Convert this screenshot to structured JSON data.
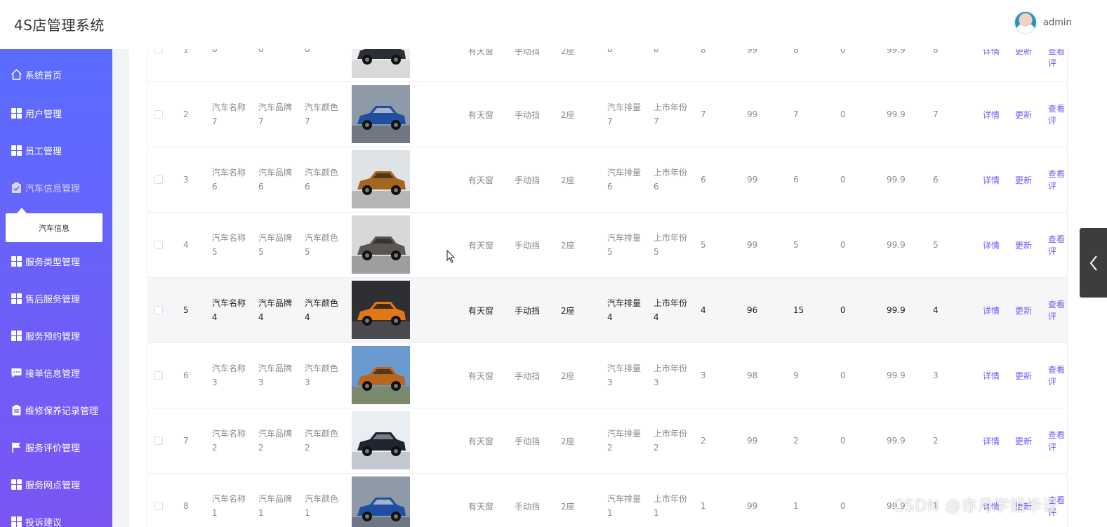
{
  "app": {
    "title": "4S店管理系统",
    "user": "admin"
  },
  "sidebar": {
    "items": [
      {
        "label": "系统首页",
        "icon": "home-icon"
      },
      {
        "label": "用户管理",
        "icon": "grid-icon"
      },
      {
        "label": "员工管理",
        "icon": "grid-icon"
      },
      {
        "label": "汽车信息管理",
        "icon": "clipboard-check-icon"
      },
      {
        "label": "服务类型管理",
        "icon": "grid-icon"
      },
      {
        "label": "售后服务管理",
        "icon": "grid-icon"
      },
      {
        "label": "服务预约管理",
        "icon": "grid-icon"
      },
      {
        "label": "接单信息管理",
        "icon": "chat-icon"
      },
      {
        "label": "维修保养记录管理",
        "icon": "clipboard-icon"
      },
      {
        "label": "服务评价管理",
        "icon": "flag-icon"
      },
      {
        "label": "服务网点管理",
        "icon": "grid-icon"
      },
      {
        "label": "投诉建议",
        "icon": "grid-icon"
      }
    ],
    "submenu_label": "汽车信息"
  },
  "table": {
    "actions": [
      "详情",
      "更新",
      "查看评"
    ],
    "rows": [
      {
        "idx": "1",
        "name": [
          "",
          "8"
        ],
        "brand": [
          "",
          "8"
        ],
        "color": [
          "",
          "8"
        ],
        "sunroof": "有天窗",
        "gear": "手动挡",
        "seats": "2座",
        "displacement": [
          "",
          "8"
        ],
        "year": [
          "",
          "8"
        ],
        "c1": "8",
        "c2": "99",
        "c3": "8",
        "c4": "0",
        "c5": "99.9",
        "c6": "8"
      },
      {
        "idx": "2",
        "name": [
          "汽车名称",
          "7"
        ],
        "brand": [
          "汽车品牌",
          "7"
        ],
        "color": [
          "汽车颜色",
          "7"
        ],
        "sunroof": "有天窗",
        "gear": "手动挡",
        "seats": "2座",
        "displacement": [
          "汽车排量",
          "7"
        ],
        "year": [
          "上市年份",
          "7"
        ],
        "c1": "7",
        "c2": "99",
        "c3": "7",
        "c4": "0",
        "c5": "99.9",
        "c6": "7"
      },
      {
        "idx": "3",
        "name": [
          "汽车名称",
          "6"
        ],
        "brand": [
          "汽车品牌",
          "6"
        ],
        "color": [
          "汽车颜色",
          "6"
        ],
        "sunroof": "有天窗",
        "gear": "手动挡",
        "seats": "2座",
        "displacement": [
          "汽车排量",
          "6"
        ],
        "year": [
          "上市年份",
          "6"
        ],
        "c1": "6",
        "c2": "99",
        "c3": "6",
        "c4": "0",
        "c5": "99.9",
        "c6": "6"
      },
      {
        "idx": "4",
        "name": [
          "汽车名称",
          "5"
        ],
        "brand": [
          "汽车品牌",
          "5"
        ],
        "color": [
          "汽车颜色",
          "5"
        ],
        "sunroof": "有天窗",
        "gear": "手动挡",
        "seats": "2座",
        "displacement": [
          "汽车排量",
          "5"
        ],
        "year": [
          "上市年份",
          "5"
        ],
        "c1": "5",
        "c2": "99",
        "c3": "5",
        "c4": "0",
        "c5": "99.9",
        "c6": "5"
      },
      {
        "idx": "5",
        "name": [
          "汽车名称",
          "4"
        ],
        "brand": [
          "汽车品牌",
          "4"
        ],
        "color": [
          "汽车颜色",
          "4"
        ],
        "sunroof": "有天窗",
        "gear": "手动挡",
        "seats": "2座",
        "displacement": [
          "汽车排量",
          "4"
        ],
        "year": [
          "上市年份",
          "4"
        ],
        "c1": "4",
        "c2": "96",
        "c3": "15",
        "c4": "0",
        "c5": "99.9",
        "c6": "4"
      },
      {
        "idx": "6",
        "name": [
          "汽车名称",
          "3"
        ],
        "brand": [
          "汽车品牌",
          "3"
        ],
        "color": [
          "汽车颜色",
          "3"
        ],
        "sunroof": "有天窗",
        "gear": "手动挡",
        "seats": "2座",
        "displacement": [
          "汽车排量",
          "3"
        ],
        "year": [
          "上市年份",
          "3"
        ],
        "c1": "3",
        "c2": "98",
        "c3": "9",
        "c4": "0",
        "c5": "99.9",
        "c6": "3"
      },
      {
        "idx": "7",
        "name": [
          "汽车名称",
          "2"
        ],
        "brand": [
          "汽车品牌",
          "2"
        ],
        "color": [
          "汽车颜色",
          "2"
        ],
        "sunroof": "有天窗",
        "gear": "手动挡",
        "seats": "2座",
        "displacement": [
          "汽车排量",
          "2"
        ],
        "year": [
          "上市年份",
          "2"
        ],
        "c1": "2",
        "c2": "99",
        "c3": "2",
        "c4": "0",
        "c5": "99.9",
        "c6": "2"
      },
      {
        "idx": "8",
        "name": [
          "汽车名称",
          "1"
        ],
        "brand": [
          "汽车品牌",
          "1"
        ],
        "color": [
          "汽车颜色",
          "1"
        ],
        "sunroof": "有天窗",
        "gear": "手动挡",
        "seats": "2座",
        "displacement": [
          "汽车排量",
          "1"
        ],
        "year": [
          "上市年份",
          "1"
        ],
        "c1": "1",
        "c2": "99",
        "c3": "1",
        "c4": "0",
        "c5": "99.9",
        "c6": "1"
      }
    ]
  },
  "watermark": "CSDN @亦月学姐毕设",
  "colors": {
    "sidebar_top": "#5b6cff",
    "sidebar_bottom": "#7a55f4",
    "link": "#7a55f4"
  }
}
